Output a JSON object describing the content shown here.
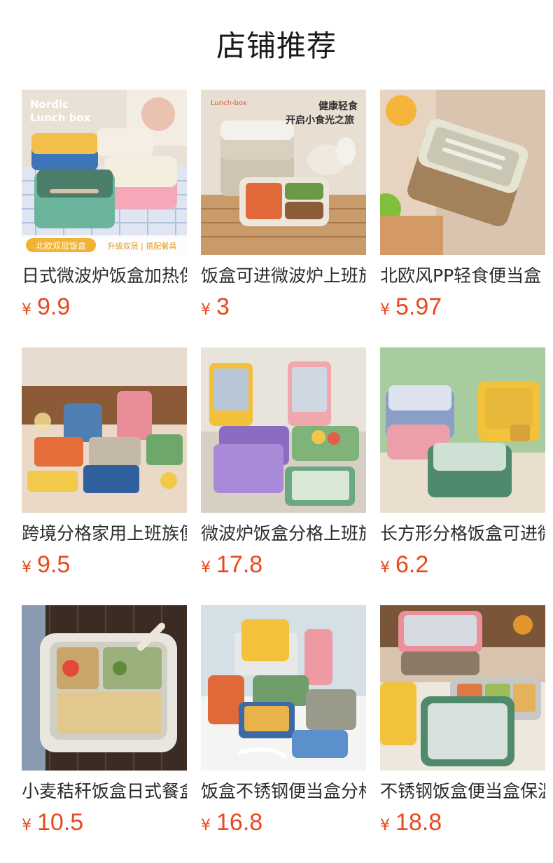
{
  "header": {
    "title": "店铺推荐"
  },
  "currency_symbol": "¥",
  "colors": {
    "price": "#e8491d",
    "title": "#1a1a1a"
  },
  "products": [
    {
      "name": "日式微波炉饭盒加热保温上班族",
      "price": "9.9",
      "image_text": [
        "Nordic",
        "Lunch box",
        "北欧双层饭盒",
        "升级双层 | 搭配餐具"
      ]
    },
    {
      "name": "饭盒可进微波炉上班族便当盒",
      "price": "3",
      "image_text": [
        "Lunch-box",
        "健康轻食",
        "开启小食光之旅"
      ]
    },
    {
      "name": "北欧风PP轻食便当盒",
      "price": "5.97",
      "image_text": []
    },
    {
      "name": "跨境分格家用上班族便当盒",
      "price": "9.5",
      "image_text": []
    },
    {
      "name": "微波炉饭盒分格上班族便当盒",
      "price": "17.8",
      "image_text": []
    },
    {
      "name": "长方形分格饭盒可进微波炉",
      "price": "6.2",
      "image_text": []
    },
    {
      "name": "小麦秸秆饭盒日式餐盒",
      "price": "10.5",
      "image_text": []
    },
    {
      "name": "饭盒不锈钢便当盒分格",
      "price": "16.8",
      "image_text": []
    },
    {
      "name": "不锈钢饭盒便当盒保温",
      "price": "18.8",
      "image_text": []
    }
  ]
}
